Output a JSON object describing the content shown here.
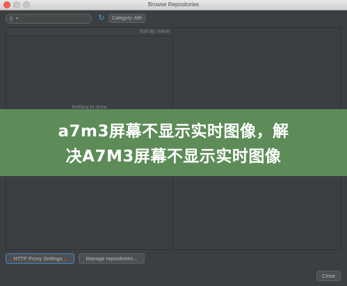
{
  "window": {
    "title": "Browse Repositories"
  },
  "toolbar": {
    "search_placeholder": "",
    "search_value": "",
    "category_label": "Category: All"
  },
  "list": {
    "sort_label": "Sort by: name",
    "empty_text": "Nothing to show"
  },
  "overlay": {
    "line1": "a7m3屏幕不显示实时图像，解",
    "line2": "决A7M3屏幕不显示实时图像"
  },
  "footer": {
    "proxy_label": "HTTP Proxy Settings...",
    "manage_label": "Manage repositories...",
    "close_label": "Close"
  },
  "icons": {
    "search": "search-icon",
    "refresh": "refresh-icon",
    "dropdown": "chevron-down-icon"
  },
  "colors": {
    "background": "#3c3f41",
    "accent": "#4aa3df",
    "banner": "#60925a"
  }
}
